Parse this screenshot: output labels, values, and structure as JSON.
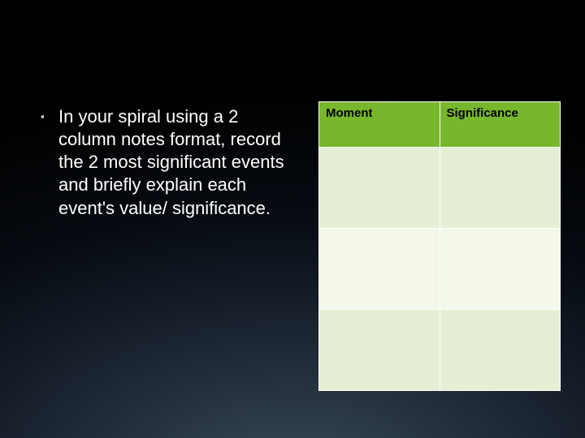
{
  "bullet": {
    "marker": "▪",
    "text": "In your spiral using a 2 column notes format, record the 2 most significant events and briefly explain each event's value/ significance."
  },
  "table": {
    "headers": [
      "Moment",
      "Significance"
    ],
    "rows": [
      [
        "",
        ""
      ],
      [
        "",
        ""
      ],
      [
        "",
        ""
      ]
    ]
  }
}
